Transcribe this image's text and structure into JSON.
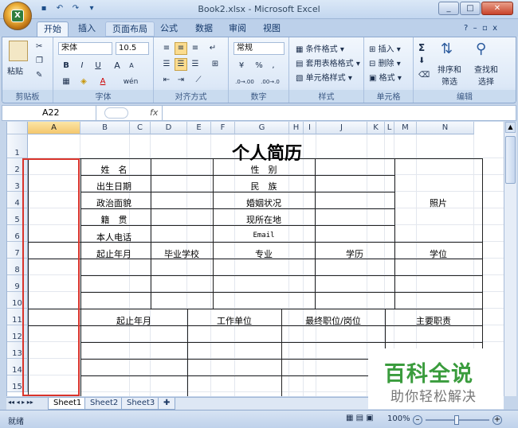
{
  "window": {
    "title": "Book2.xlsx - Microsoft Excel",
    "office_badge": "X"
  },
  "quick_access": [
    {
      "icon": "save-icon",
      "glyph": "▪"
    },
    {
      "icon": "undo-icon",
      "glyph": "↶"
    },
    {
      "icon": "redo-icon",
      "glyph": "↷"
    },
    {
      "icon": "customize-icon",
      "glyph": "▾"
    }
  ],
  "tabs": [
    "开始",
    "插入",
    "页面布局",
    "公式",
    "数据",
    "审阅",
    "视图"
  ],
  "ribbon": {
    "clipboard": {
      "label": "剪贴板",
      "paste": "粘贴"
    },
    "font": {
      "label": "字体",
      "name": "宋体",
      "size": "10.5",
      "bold": "B",
      "italic": "I",
      "underline": "U",
      "grow": "A",
      "shrink": "A",
      "wen": "wén"
    },
    "alignment": {
      "label": "对齐方式"
    },
    "number": {
      "label": "数字",
      "format": "常规",
      "percent": "%",
      "comma": ",",
      "inc_decimal": ".0→.00",
      "dec_decimal": ".00→.0"
    },
    "styles": {
      "label": "样式",
      "conditional": "条件格式",
      "table": "套用表格格式",
      "cell": "单元格样式"
    },
    "cells": {
      "label": "单元格",
      "insert": "插入",
      "delete": "删除",
      "format": "格式"
    },
    "editing": {
      "label": "编辑",
      "sum": "Σ",
      "sort": "排序和\n筛选",
      "find": "查找和\n选择"
    }
  },
  "formula_bar": {
    "name_box": "A22",
    "fx": "fx",
    "value": ""
  },
  "columns": [
    "A",
    "B",
    "C",
    "D",
    "E",
    "F",
    "G",
    "H",
    "I",
    "J",
    "K",
    "L",
    "M",
    "N"
  ],
  "rows": [
    "1",
    "2",
    "3",
    "4",
    "5",
    "6",
    "7",
    "8",
    "9",
    "10",
    "11",
    "12",
    "13",
    "14",
    "15"
  ],
  "resume": {
    "title": "个人简历",
    "name": "姓　名",
    "birth": "出生日期",
    "political": "政治面貌",
    "native": "籍　贯",
    "phone": "本人电话",
    "gender": "性　别",
    "ethnic": "民　族",
    "marital": "婚姻状况",
    "residence": "现所在地",
    "email": "Email",
    "photo": "照片",
    "edu_start": "起止年月",
    "school": "毕业学校",
    "major": "专业",
    "degree_level": "学历",
    "degree": "学位",
    "work_start": "起止年月",
    "employer": "工作单位",
    "position": "最终职位/岗位",
    "duties": "主要职责"
  },
  "sheets": [
    "Sheet1",
    "Sheet2",
    "Sheet3"
  ],
  "status": {
    "mode": "就绪",
    "zoom": "100%"
  },
  "watermark": {
    "line1": "百科全说",
    "line2": "助你轻松解决"
  },
  "colors": {
    "selection": "#d9342b",
    "watermark_green": "#3a9c3d",
    "ribbon_blue": "#dce8f7"
  }
}
